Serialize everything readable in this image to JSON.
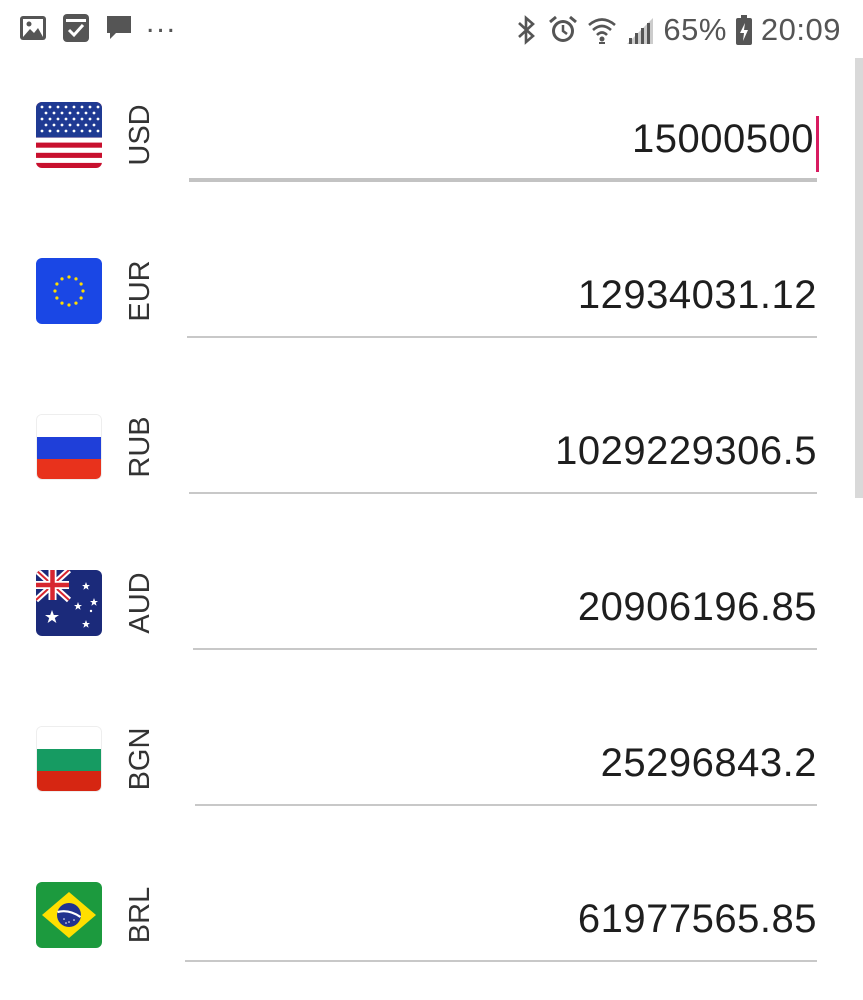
{
  "status_bar": {
    "left_icons": [
      "image-icon",
      "checklist-icon",
      "chat-bubble-icon"
    ],
    "more": "...",
    "right_icons": [
      "bluetooth-icon",
      "alarm-icon",
      "wifi-icon",
      "signal-icon",
      "battery-icon"
    ],
    "battery": "65%",
    "time": "20:09"
  },
  "currencies": [
    {
      "code": "USD",
      "flag": "us-flag-icon",
      "amount": "15000500",
      "focused": true
    },
    {
      "code": "EUR",
      "flag": "eu-flag-icon",
      "amount": "12934031.12",
      "focused": false
    },
    {
      "code": "RUB",
      "flag": "ru-flag-icon",
      "amount": "1029229306.5",
      "focused": false
    },
    {
      "code": "AUD",
      "flag": "au-flag-icon",
      "amount": "20906196.85",
      "focused": false
    },
    {
      "code": "BGN",
      "flag": "bg-flag-icon",
      "amount": "25296843.2",
      "focused": false
    },
    {
      "code": "BRL",
      "flag": "br-flag-icon",
      "amount": "61977565.85",
      "focused": false
    }
  ],
  "colors": {
    "caret": "#d81b60",
    "underline": "#c8c8c8"
  }
}
